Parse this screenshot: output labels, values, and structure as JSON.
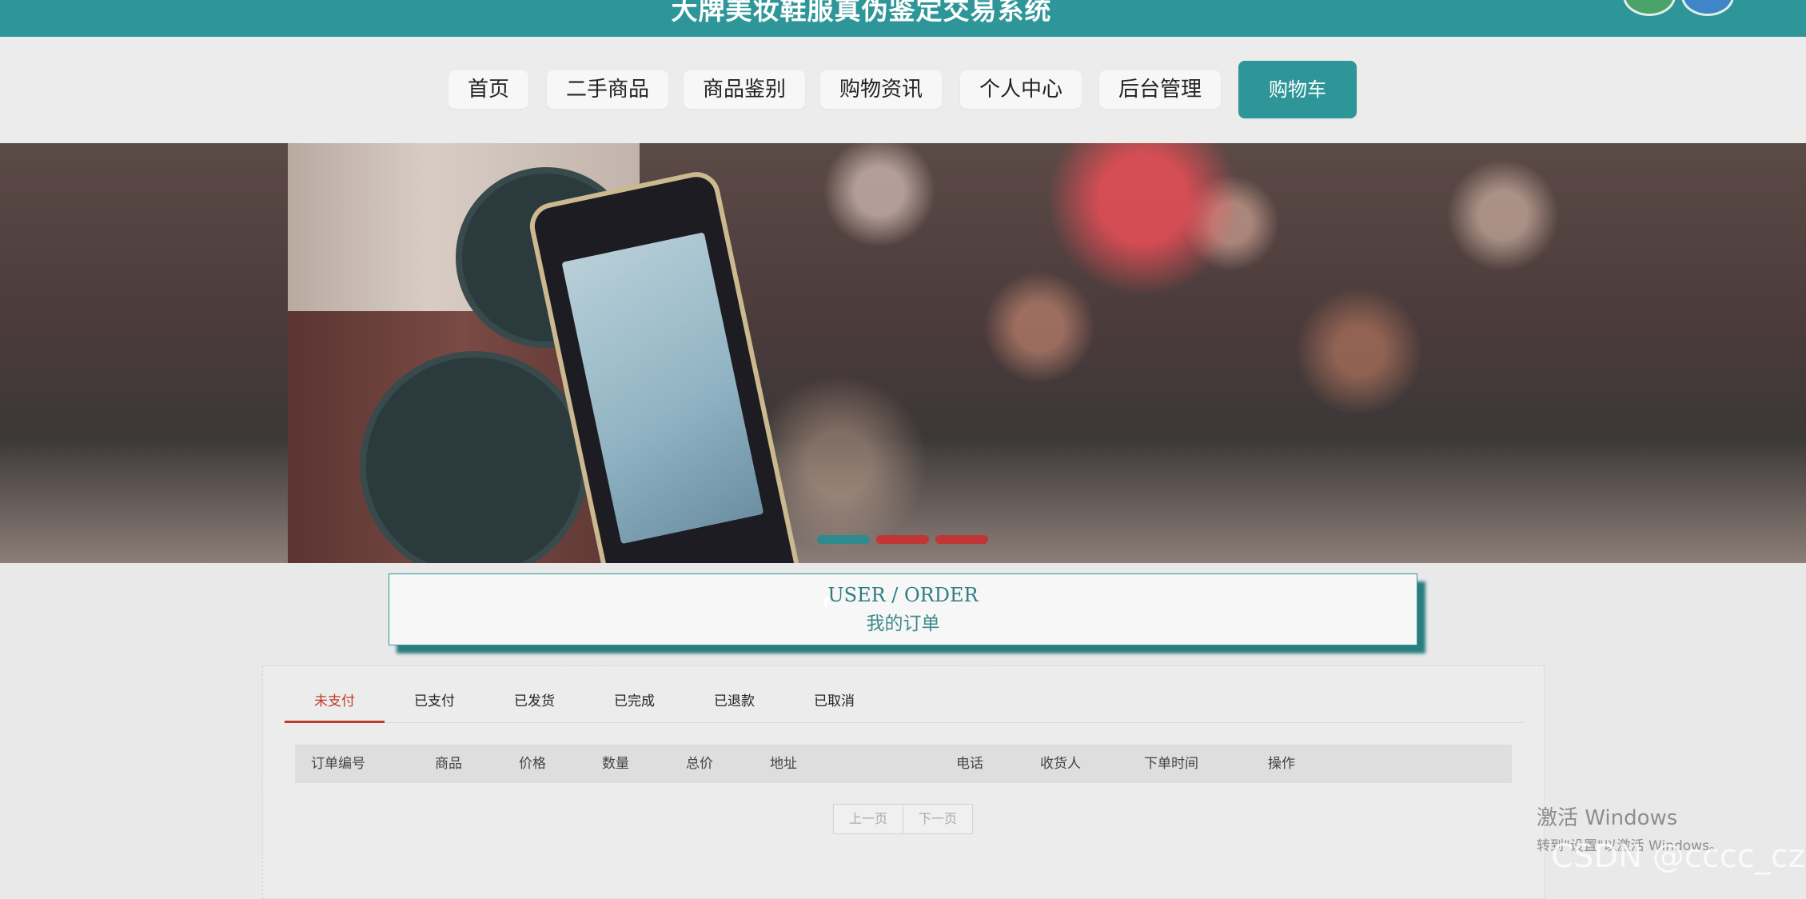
{
  "site": {
    "title": "大牌美妆鞋服真伪鉴定交易系统"
  },
  "nav": {
    "items": [
      "首页",
      "二手商品",
      "商品鉴别",
      "购物资讯",
      "个人中心",
      "后台管理"
    ],
    "cart": "购物车"
  },
  "banner": {
    "slides": 3,
    "active_slide": 1
  },
  "section": {
    "title_en": "USER / ORDER",
    "title_cn": "我的订单"
  },
  "orders": {
    "tabs": [
      "未支付",
      "已支付",
      "已发货",
      "已完成",
      "已退款",
      "已取消"
    ],
    "active_tab": "未支付",
    "columns": [
      "订单编号",
      "商品",
      "价格",
      "数量",
      "总价",
      "地址",
      "电话",
      "收货人",
      "下单时间",
      "操作"
    ],
    "rows": []
  },
  "pagination": {
    "prev": "上一页",
    "next": "下一页"
  },
  "overlay": {
    "windows_activate": "激活 Windows",
    "windows_activate_sub": "转到\"设置\"以激活 Windows。",
    "watermark": "CSDN @cccc_cz"
  },
  "colors": {
    "accent": "#2e9698",
    "active_tab": "#c0392b"
  }
}
